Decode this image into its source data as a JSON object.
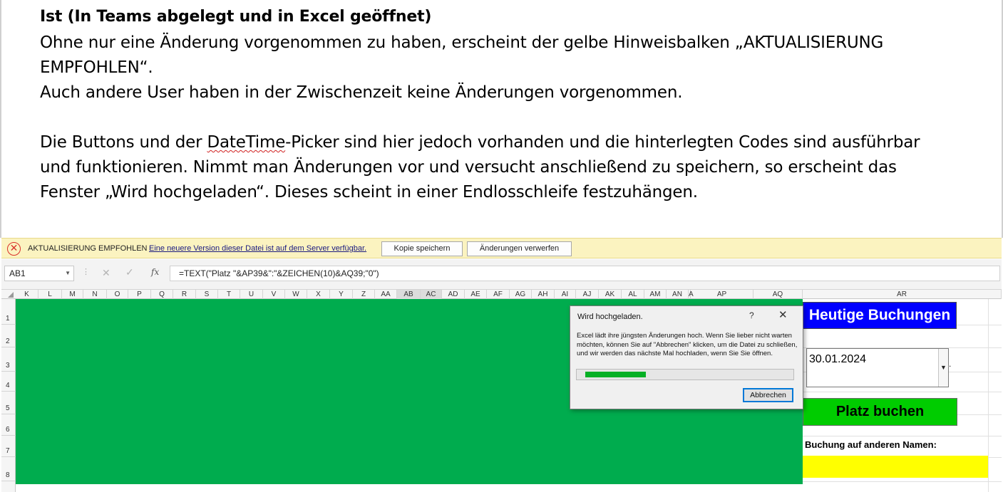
{
  "document": {
    "title": "Ist (In Teams abgelegt und in Excel geöffnet)",
    "line1": "Ohne nur eine Änderung vorgenommen zu haben, erscheint der gelbe Hinweisbalken „AKTUALISIERUNG",
    "line2": "EMPFOHLEN“.",
    "line3": "Auch andere User haben in der Zwischenzeit keine Änderungen vorgenommen.",
    "line4_pre": "Die Buttons und der ",
    "line4_word": "DateTime",
    "line4_post": "-Picker sind hier jedoch vorhanden und die hinterlegten Codes sind ausführbar",
    "line5": "und funktionieren. Nimmt man Änderungen vor und versucht anschließend zu speichern, so erscheint das",
    "line6": "Fenster „Wird hochgeladen“. Dieses scheint in einer Endlosschleife festzuhängen."
  },
  "infobar": {
    "icon": "error-circle-x-icon",
    "title": "AKTUALISIERUNG EMPFOHLEN",
    "message": "Eine neuere Version dieser Datei ist auf dem Server verfügbar.",
    "save_copy_label": "Kopie speichern",
    "discard_label": "Änderungen verwerfen",
    "background": "#fbf3c0"
  },
  "formula_bar": {
    "name_box": "AB1",
    "fx_label": "fx",
    "formula": "=TEXT(\"Platz \"&AP39&\":\"&ZEICHEN(10)&AQ39;\"0\")"
  },
  "columns": [
    "K",
    "L",
    "M",
    "N",
    "O",
    "P",
    "Q",
    "R",
    "S",
    "T",
    "U",
    "V",
    "W",
    "X",
    "Y",
    "Z",
    "AA",
    "AB",
    "AC",
    "AD",
    "AE",
    "AF",
    "AG",
    "AH",
    "AI",
    "AJ",
    "AK",
    "AL",
    "AM",
    "AN",
    "A",
    "AP",
    "AQ",
    "AR"
  ],
  "rows": [
    "1",
    "2",
    "3",
    "4",
    "5",
    "6",
    "7",
    "8"
  ],
  "sheet": {
    "green_range_color": "#00ac4e",
    "today_bookings_label": "Heutige Buchungen",
    "date_value": "30.01.2024",
    "book_button_label": "Platz buchen",
    "other_name_label": "Buchung auf anderen Namen:",
    "other_name_color": "#ffff00"
  },
  "dialog": {
    "title": "Wird hochgeladen.",
    "help": "?",
    "close": "✕",
    "message": "Excel lädt ihre jüngsten Änderungen hoch. Wenn Sie lieber nicht warten möchten, können Sie auf \"Abbrechen\" klicken, um die Datei zu schließen, und wir werden das nächste Mal hochladen, wenn Sie Sie öffnen.",
    "progress": 0.3,
    "cancel_label": "Abbrechen"
  }
}
